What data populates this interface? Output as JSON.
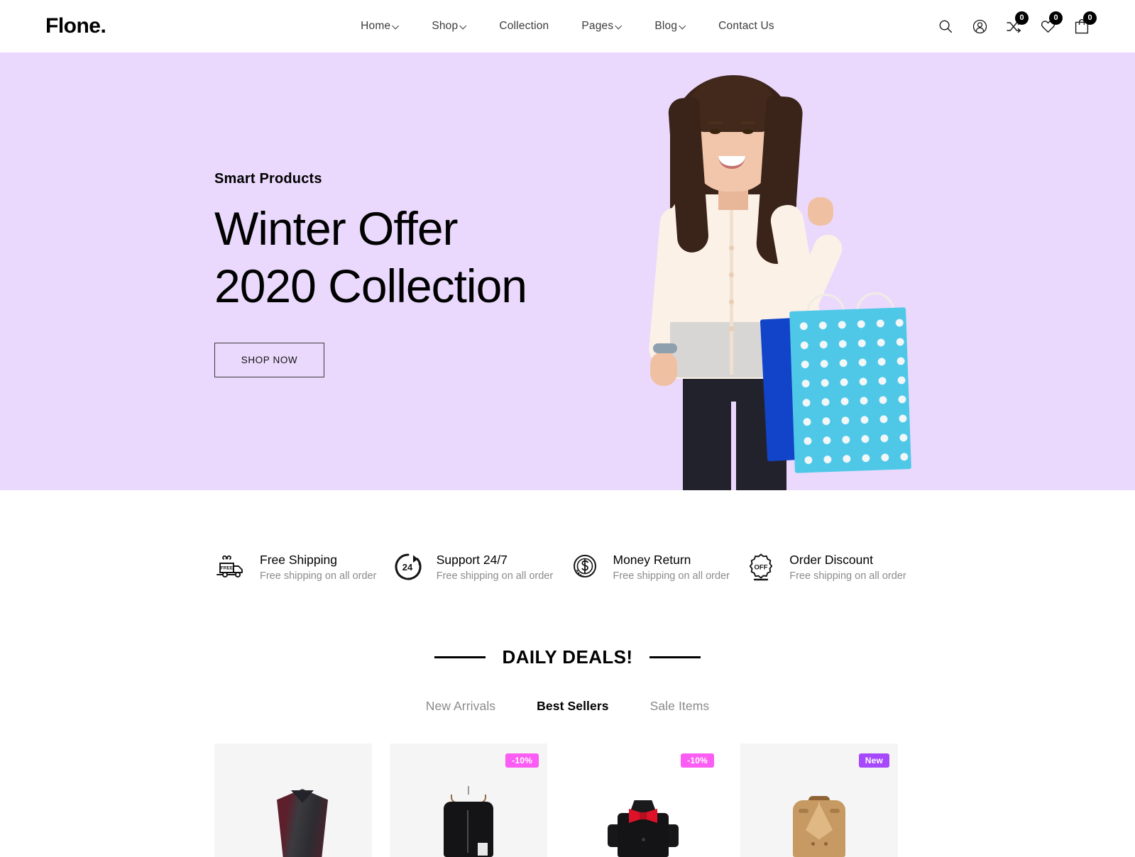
{
  "header": {
    "logo": "Flone.",
    "nav": [
      {
        "label": "Home",
        "has_caret": true
      },
      {
        "label": "Shop",
        "has_caret": true
      },
      {
        "label": "Collection",
        "has_caret": false
      },
      {
        "label": "Pages",
        "has_caret": true
      },
      {
        "label": "Blog",
        "has_caret": true
      },
      {
        "label": "Contact Us",
        "has_caret": false
      }
    ],
    "icons": {
      "search": "search-icon",
      "account": "user-account-icon",
      "compare": "compare-shuffle-icon",
      "wishlist": "heart-icon",
      "cart": "shopping-bag-icon"
    },
    "counts": {
      "compare": "0",
      "wishlist": "0",
      "cart": "0"
    }
  },
  "hero": {
    "eyebrow": "Smart Products",
    "title_line1": "Winter Offer",
    "title_line2": "2020 Collection",
    "cta": "SHOP NOW",
    "background_color": "#ead9fd"
  },
  "features": [
    {
      "icon": "delivery-truck-icon",
      "title": "Free Shipping",
      "subtitle": "Free shipping on all order"
    },
    {
      "icon": "support-24-7-icon",
      "title": "Support 24/7",
      "subtitle": "Free shipping on all order"
    },
    {
      "icon": "money-return-icon",
      "title": "Money Return",
      "subtitle": "Free shipping on all order"
    },
    {
      "icon": "order-discount-icon",
      "title": "Order Discount",
      "subtitle": "Free shipping on all order"
    }
  ],
  "deals": {
    "section_title": "DAILY DEALS!",
    "tabs": [
      {
        "label": "New Arrivals",
        "active": false
      },
      {
        "label": "Best Sellers",
        "active": true
      },
      {
        "label": "Sale Items",
        "active": false
      }
    ],
    "badge_colors": {
      "discount": "#fb5cf4",
      "new": "#a649fd"
    },
    "products": [
      {
        "art": "poncho",
        "badge": null,
        "badge_type": null,
        "panel": true
      },
      {
        "art": "jacket",
        "badge": "-10%",
        "badge_type": "discount",
        "panel": true
      },
      {
        "art": "bowtie-shirt",
        "badge": "-10%",
        "badge_type": "discount",
        "panel": false
      },
      {
        "art": "trench-coat",
        "badge": "New",
        "badge_type": "new",
        "panel": true
      }
    ]
  }
}
